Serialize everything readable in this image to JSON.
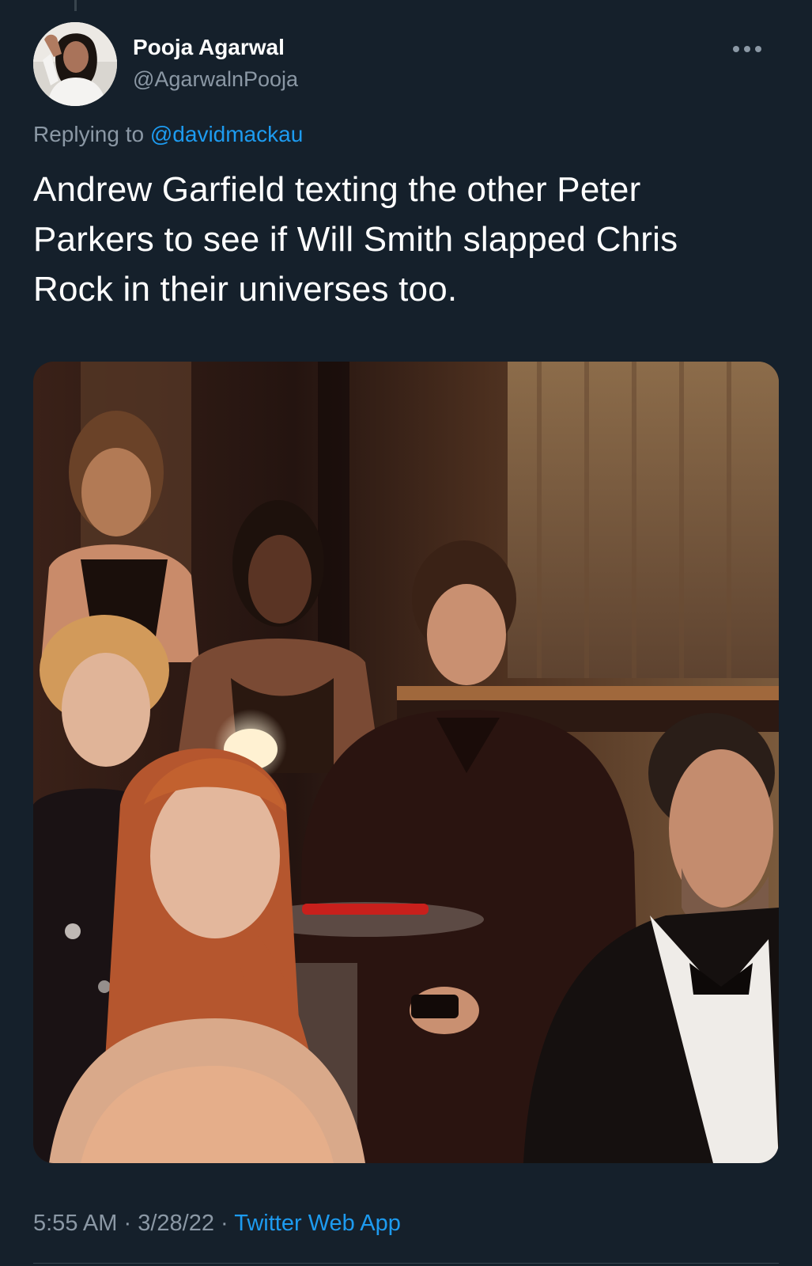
{
  "author": {
    "display_name": "Pooja Agarwal",
    "handle": "@AgarwalnPooja",
    "avatar": "profile-photo"
  },
  "reply": {
    "prefix": "Replying to",
    "mention": "@davidmackau"
  },
  "tweet": {
    "lines": [
      "Andrew Garfield texting the other Peter",
      "Parkers to see if Will Smith slapped Chris",
      "Rock in their universes too."
    ]
  },
  "media": {
    "type": "photo"
  },
  "meta": {
    "time": "5:55 AM",
    "separator": "·",
    "date": "3/28/22",
    "source": "Twitter Web App"
  },
  "icons": {
    "more": "more-horizontal-icon"
  },
  "colors": {
    "background": "#15202b",
    "text_primary": "#ffffff",
    "text_secondary": "#8b98a5",
    "link": "#1d9bf0",
    "divider": "#38444d"
  }
}
